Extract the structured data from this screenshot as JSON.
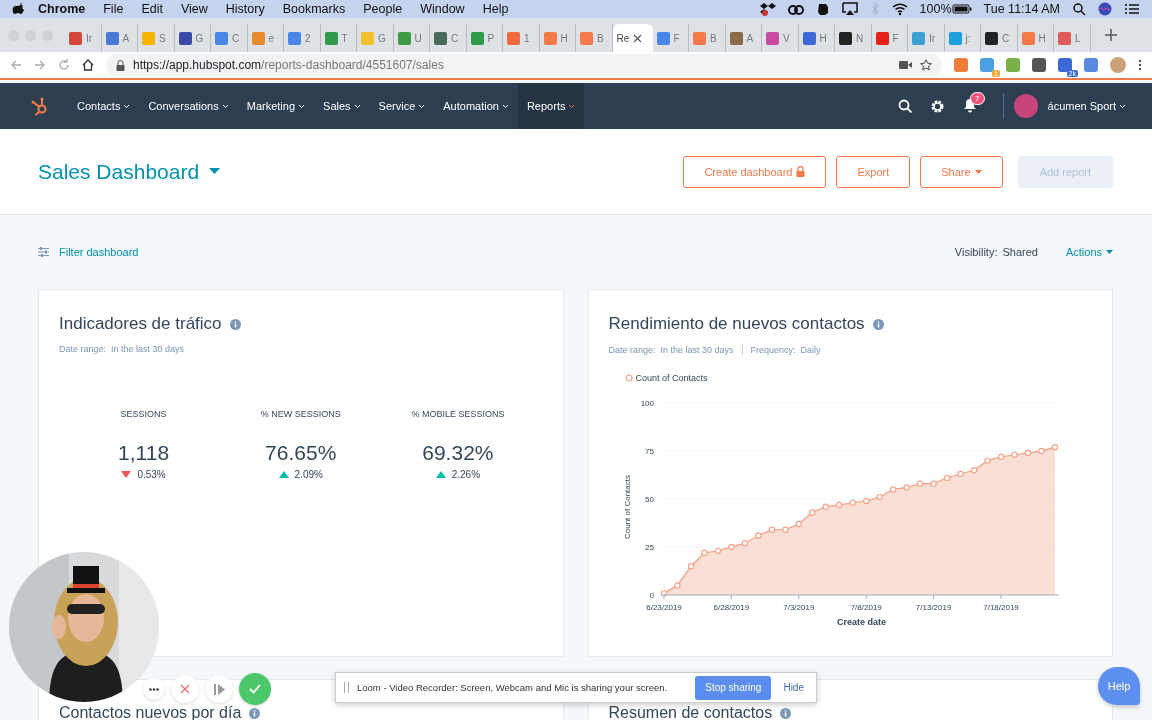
{
  "menubar": {
    "app": "Chrome",
    "menus": [
      "File",
      "Edit",
      "View",
      "History",
      "Bookmarks",
      "People",
      "Window",
      "Help"
    ],
    "battery": "100%",
    "clock": "Tue 11:14 AM"
  },
  "browser": {
    "tabs": [
      {
        "label": "Ir",
        "color": "#d44638",
        "selected": false
      },
      {
        "label": "A",
        "color": "#4a78d6",
        "selected": false
      },
      {
        "label": "S",
        "color": "#f4b400",
        "selected": false
      },
      {
        "label": "G",
        "color": "#3b4aa8",
        "selected": false
      },
      {
        "label": "C",
        "color": "#4a86e8",
        "selected": false
      },
      {
        "label": "e",
        "color": "#e88a2c",
        "selected": false
      },
      {
        "label": "2",
        "color": "#4a86e8",
        "selected": false
      },
      {
        "label": "T",
        "color": "#2e9a4a",
        "selected": false
      },
      {
        "label": "G",
        "color": "#f2c12e",
        "selected": false
      },
      {
        "label": "U",
        "color": "#3e9b45",
        "selected": false
      },
      {
        "label": "C",
        "color": "#4a6a5a",
        "selected": false
      },
      {
        "label": "P",
        "color": "#2e9a4a",
        "selected": false
      },
      {
        "label": "1",
        "color": "#f06a3e",
        "selected": false
      },
      {
        "label": "H",
        "color": "#f47a4a",
        "selected": false
      },
      {
        "label": "B",
        "color": "#f47a4a",
        "selected": false
      },
      {
        "label": "Re",
        "selected": true
      },
      {
        "label": "F",
        "color": "#4a86e8",
        "selected": false
      },
      {
        "label": "B",
        "color": "#f47a4a",
        "selected": false
      },
      {
        "label": "A",
        "color": "#8a6a4a",
        "selected": false
      },
      {
        "label": "V",
        "color": "#c84aa0",
        "selected": false
      },
      {
        "label": "H",
        "color": "#3b6ad6",
        "selected": false
      },
      {
        "label": "N",
        "color": "#222222",
        "selected": false
      },
      {
        "label": "F",
        "color": "#e62117",
        "selected": false
      },
      {
        "label": "Ir",
        "color": "#3aa0d0",
        "selected": false
      },
      {
        "label": "j:",
        "color": "#1ea0e0",
        "selected": false
      },
      {
        "label": "C",
        "color": "#222222",
        "selected": false
      },
      {
        "label": "H",
        "color": "#f47a4a",
        "selected": false
      },
      {
        "label": "L",
        "color": "#e05a5a",
        "selected": false
      }
    ],
    "url_host": "https://app.hubspot.com",
    "url_path": "/reports-dashboard/4551607/sales",
    "extensions": [
      {
        "color": "#f07c3a"
      },
      {
        "color": "#4aa0e0",
        "badge": "1"
      },
      {
        "color": "#7ab04a"
      },
      {
        "color": "#555555"
      },
      {
        "color": "#3b6ad6",
        "badge": "2k"
      },
      {
        "color": "#5a8ae0"
      }
    ]
  },
  "nav": {
    "items": [
      {
        "label": "Contacts",
        "selected": false
      },
      {
        "label": "Conversations",
        "selected": false
      },
      {
        "label": "Marketing",
        "selected": false
      },
      {
        "label": "Sales",
        "selected": false
      },
      {
        "label": "Service",
        "selected": false
      },
      {
        "label": "Automation",
        "selected": false
      },
      {
        "label": "Reports",
        "selected": true
      }
    ],
    "notifications": "7",
    "account": "ácumen Sport"
  },
  "header": {
    "title": "Sales Dashboard",
    "buttons": [
      {
        "label": "Create dashboard",
        "kind": "locked",
        "disabled": false
      },
      {
        "label": "Export",
        "kind": "plain",
        "disabled": false
      },
      {
        "label": "Share",
        "kind": "dropdown",
        "disabled": false
      },
      {
        "label": "Add report",
        "kind": "plain",
        "disabled": true
      }
    ]
  },
  "toolbar": {
    "filter": "Filter dashboard",
    "visibility_label": "Visibility:",
    "visibility": "Shared",
    "actions": "Actions"
  },
  "traffic_card": {
    "title": "Indicadores de tráfico",
    "date_range_label": "Date range:",
    "date_range": "In the last 30 days",
    "metrics": [
      {
        "label": "SESSIONS",
        "value": "1,118",
        "change": "0.53%",
        "increase": false
      },
      {
        "label": "% NEW SESSIONS",
        "value": "76.65%",
        "change": "2.09%",
        "increase": true
      },
      {
        "label": "% MOBILE SESSIONS",
        "value": "69.32%",
        "change": "2.26%",
        "increase": true
      }
    ]
  },
  "contacts_card": {
    "title": "Rendimiento de nuevos contactos",
    "date_range_label": "Date range:",
    "date_range": "In the last 30 days",
    "frequency_label": "Frequency:",
    "frequency": "Daily",
    "chart_data": {
      "type": "area",
      "xlabel": "Create date",
      "ylabel": "Count of Contacts",
      "categories": [
        "6/23/2019",
        null,
        null,
        null,
        null,
        "6/28/2019",
        null,
        null,
        null,
        null,
        "7/3/2019",
        null,
        null,
        null,
        null,
        "7/8/2019",
        null,
        null,
        null,
        null,
        "7/13/2019",
        null,
        null,
        null,
        null,
        "7/18/2019",
        null,
        null,
        null,
        null
      ],
      "series": [
        {
          "name": "Count of Contacts",
          "color": "#f2a38a",
          "values": [
            1,
            5,
            15,
            22,
            23,
            25,
            27,
            31,
            34,
            34,
            37,
            43,
            46,
            47,
            48,
            49,
            51,
            55,
            56,
            58,
            58,
            61,
            63,
            65,
            70,
            72,
            73,
            74,
            75,
            77
          ]
        }
      ],
      "ylim": [
        0,
        100
      ],
      "yticks": [
        0,
        25,
        50,
        75,
        100
      ],
      "grid": true
    }
  },
  "bottom_cards": [
    {
      "title": "Contactos nuevos por día"
    },
    {
      "title": "Resumen de contactos"
    }
  ],
  "loom": {
    "message": "Loom - Video Recorder: Screen, Webcam and Mic is sharing your screen.",
    "stop": "Stop sharing",
    "hide": "Hide"
  },
  "help": "Help"
}
